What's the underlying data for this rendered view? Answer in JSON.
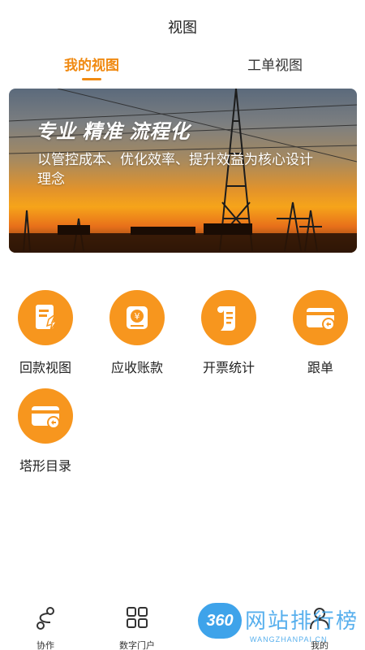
{
  "header": {
    "title": "视图"
  },
  "tabs": [
    {
      "label": "我的视图",
      "active": true
    },
    {
      "label": "工单视图",
      "active": false
    }
  ],
  "banner": {
    "slogan": "专业 精准 流程化",
    "subtitle": "以管控成本、优化效率、提升效益为核心设计理念"
  },
  "grid": [
    {
      "label": "回款视图",
      "icon": "payment-document-icon"
    },
    {
      "label": "应收账款",
      "icon": "yen-receivable-icon"
    },
    {
      "label": "开票统计",
      "icon": "invoice-scroll-icon"
    },
    {
      "label": "跟单",
      "icon": "card-follow-icon"
    },
    {
      "label": "塔形目录",
      "icon": "card-catalog-icon"
    }
  ],
  "bottom_nav": [
    {
      "label": "协作",
      "icon": "collaboration-icon"
    },
    {
      "label": "数字门户",
      "icon": "grid-portal-icon"
    },
    {
      "label": "",
      "icon": "center-icon"
    },
    {
      "label": "我的",
      "icon": "user-icon"
    }
  ],
  "watermark": {
    "badge": "360",
    "text": "网站排行榜",
    "url": "WANGZHANPAI.CN"
  },
  "colors": {
    "accent": "#f08a12",
    "icon_bg": "#f7961e",
    "watermark": "#3aa2ea"
  }
}
